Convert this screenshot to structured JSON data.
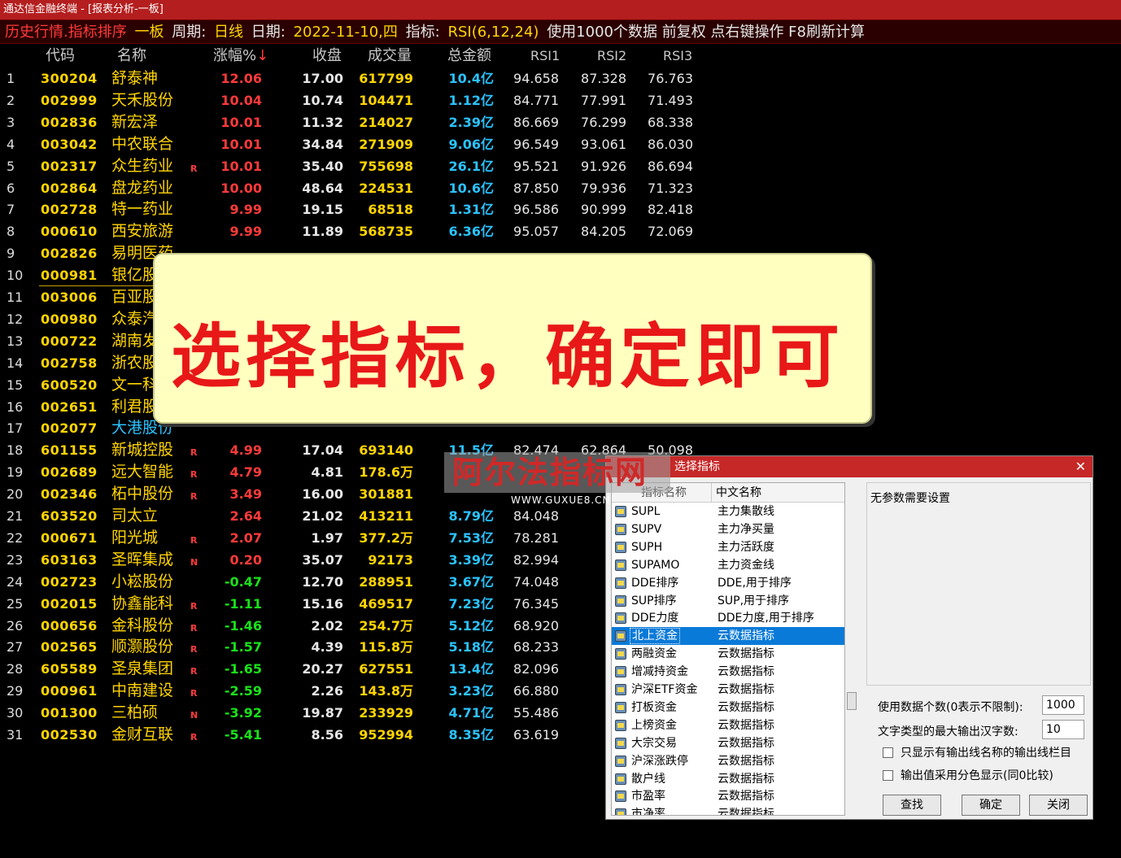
{
  "window": {
    "title": "通达信金融终端 - [报表分析-一板]"
  },
  "infobar": {
    "module": "历史行情.指标排序",
    "board": "一板",
    "period_label": "周期:",
    "period_value": "日线",
    "date_label": "日期:",
    "date_value": "2022-11-10,四",
    "indicator_label": "指标:",
    "indicator_value": "RSI(6,12,24)",
    "tail": "使用1000个数据 前复权 点右键操作 F8刷新计算"
  },
  "table": {
    "headers": [
      "代码",
      "名称",
      "涨幅%",
      "收盘",
      "成交量",
      "总金额",
      "RSI1",
      "RSI2",
      "RSI3"
    ],
    "sort_arrow": "↓",
    "rows": [
      {
        "i": "1",
        "code": "300204",
        "name": "舒泰神",
        "flag": "",
        "chg": "12.06",
        "close": "17.00",
        "vol": "617799",
        "amt": "10.4亿",
        "r1": "94.658",
        "r2": "87.328",
        "r3": "76.763"
      },
      {
        "i": "2",
        "code": "002999",
        "name": "天禾股份",
        "flag": "",
        "chg": "10.04",
        "close": "10.74",
        "vol": "104471",
        "amt": "1.12亿",
        "r1": "84.771",
        "r2": "77.991",
        "r3": "71.493"
      },
      {
        "i": "3",
        "code": "002836",
        "name": "新宏泽",
        "flag": "",
        "chg": "10.01",
        "close": "11.32",
        "vol": "214027",
        "amt": "2.39亿",
        "r1": "86.669",
        "r2": "76.299",
        "r3": "68.338"
      },
      {
        "i": "4",
        "code": "003042",
        "name": "中农联合",
        "flag": "",
        "chg": "10.01",
        "close": "34.84",
        "vol": "271909",
        "amt": "9.06亿",
        "r1": "96.549",
        "r2": "93.061",
        "r3": "86.030"
      },
      {
        "i": "5",
        "code": "002317",
        "name": "众生药业",
        "flag": "R",
        "chg": "10.01",
        "close": "35.40",
        "vol": "755698",
        "amt": "26.1亿",
        "r1": "95.521",
        "r2": "91.926",
        "r3": "86.694"
      },
      {
        "i": "6",
        "code": "002864",
        "name": "盘龙药业",
        "flag": "",
        "chg": "10.00",
        "close": "48.64",
        "vol": "224531",
        "amt": "10.6亿",
        "r1": "87.850",
        "r2": "79.936",
        "r3": "71.323"
      },
      {
        "i": "7",
        "code": "002728",
        "name": "特一药业",
        "flag": "",
        "chg": "9.99",
        "close": "19.15",
        "vol": "68518",
        "amt": "1.31亿",
        "r1": "96.586",
        "r2": "90.999",
        "r3": "82.418"
      },
      {
        "i": "8",
        "code": "000610",
        "name": "西安旅游",
        "flag": "",
        "chg": "9.99",
        "close": "11.89",
        "vol": "568735",
        "amt": "6.36亿",
        "r1": "95.057",
        "r2": "84.205",
        "r3": "72.069"
      },
      {
        "i": "9",
        "code": "002826",
        "name": "易明医药",
        "flag": "",
        "chg": "",
        "close": "",
        "vol": "",
        "amt": "",
        "r1": "",
        "r2": "",
        "r3": ""
      },
      {
        "i": "10",
        "code": "000981",
        "name": "银亿股份",
        "flag": "",
        "chg": "",
        "close": "",
        "vol": "",
        "amt": "",
        "r1": "",
        "r2": "",
        "r3": ""
      },
      {
        "i": "11",
        "code": "003006",
        "name": "百亚股份",
        "flag": "",
        "chg": "",
        "close": "",
        "vol": "",
        "amt": "",
        "r1": "",
        "r2": "",
        "r3": ""
      },
      {
        "i": "12",
        "code": "000980",
        "name": "众泰汽车",
        "flag": "",
        "chg": "",
        "close": "",
        "vol": "",
        "amt": "",
        "r1": "",
        "r2": "",
        "r3": ""
      },
      {
        "i": "13",
        "code": "000722",
        "name": "湖南发展",
        "flag": "",
        "chg": "",
        "close": "",
        "vol": "",
        "amt": "",
        "r1": "",
        "r2": "",
        "r3": ""
      },
      {
        "i": "14",
        "code": "002758",
        "name": "浙农股份",
        "flag": "",
        "chg": "",
        "close": "",
        "vol": "",
        "amt": "",
        "r1": "",
        "r2": "",
        "r3": ""
      },
      {
        "i": "15",
        "code": "600520",
        "name": "文一科技",
        "flag": "",
        "chg": "",
        "close": "",
        "vol": "",
        "amt": "",
        "r1": "",
        "r2": "",
        "r3": ""
      },
      {
        "i": "16",
        "code": "002651",
        "name": "利君股份",
        "flag": "",
        "chg": "",
        "close": "",
        "vol": "",
        "amt": "",
        "r1": "",
        "r2": "",
        "r3": ""
      },
      {
        "i": "17",
        "code": "002077",
        "name": "大港股份",
        "flag": "",
        "chg": "",
        "close": "",
        "vol": "",
        "amt": "",
        "r1": "",
        "r2": "",
        "r3": ""
      },
      {
        "i": "18",
        "code": "601155",
        "name": "新城控股",
        "flag": "R",
        "chg": "4.99",
        "close": "17.04",
        "vol": "693140",
        "amt": "11.5亿",
        "r1": "82.474",
        "r2": "62.864",
        "r3": "50.098"
      },
      {
        "i": "19",
        "code": "002689",
        "name": "远大智能",
        "flag": "R",
        "chg": "4.79",
        "close": "4.81",
        "vol": "178.6万",
        "amt": "",
        "r1": "",
        "r2": "",
        "r3": ""
      },
      {
        "i": "20",
        "code": "002346",
        "name": "柘中股份",
        "flag": "R",
        "chg": "3.49",
        "close": "16.00",
        "vol": "301881",
        "amt": "",
        "r1": "",
        "r2": "",
        "r3": ""
      },
      {
        "i": "21",
        "code": "603520",
        "name": "司太立",
        "flag": "",
        "chg": "2.64",
        "close": "21.02",
        "vol": "413211",
        "amt": "8.79亿",
        "r1": "84.048",
        "r2": "",
        "r3": ""
      },
      {
        "i": "22",
        "code": "000671",
        "name": "阳光城",
        "flag": "R",
        "chg": "2.07",
        "close": "1.97",
        "vol": "377.2万",
        "amt": "7.53亿",
        "r1": "78.281",
        "r2": "",
        "r3": ""
      },
      {
        "i": "23",
        "code": "603163",
        "name": "圣晖集成",
        "flag": "N",
        "chg": "0.20",
        "close": "35.07",
        "vol": "92173",
        "amt": "3.39亿",
        "r1": "82.994",
        "r2": "",
        "r3": ""
      },
      {
        "i": "24",
        "code": "002723",
        "name": "小崧股份",
        "flag": "",
        "chg": "-0.47",
        "close": "12.70",
        "vol": "288951",
        "amt": "3.67亿",
        "r1": "74.048",
        "r2": "",
        "r3": ""
      },
      {
        "i": "25",
        "code": "002015",
        "name": "协鑫能科",
        "flag": "R",
        "chg": "-1.11",
        "close": "15.16",
        "vol": "469517",
        "amt": "7.23亿",
        "r1": "76.345",
        "r2": "",
        "r3": ""
      },
      {
        "i": "26",
        "code": "000656",
        "name": "金科股份",
        "flag": "R",
        "chg": "-1.46",
        "close": "2.02",
        "vol": "254.7万",
        "amt": "5.12亿",
        "r1": "68.920",
        "r2": "",
        "r3": ""
      },
      {
        "i": "27",
        "code": "002565",
        "name": "顺灏股份",
        "flag": "R",
        "chg": "-1.57",
        "close": "4.39",
        "vol": "115.8万",
        "amt": "5.18亿",
        "r1": "68.233",
        "r2": "",
        "r3": ""
      },
      {
        "i": "28",
        "code": "605589",
        "name": "圣泉集团",
        "flag": "R",
        "chg": "-1.65",
        "close": "20.27",
        "vol": "627551",
        "amt": "13.4亿",
        "r1": "82.096",
        "r2": "",
        "r3": ""
      },
      {
        "i": "29",
        "code": "000961",
        "name": "中南建设",
        "flag": "R",
        "chg": "-2.59",
        "close": "2.26",
        "vol": "143.8万",
        "amt": "3.23亿",
        "r1": "66.880",
        "r2": "",
        "r3": ""
      },
      {
        "i": "30",
        "code": "001300",
        "name": "三柏硕",
        "flag": "N",
        "chg": "-3.92",
        "close": "19.87",
        "vol": "233929",
        "amt": "4.71亿",
        "r1": "55.486",
        "r2": "",
        "r3": ""
      },
      {
        "i": "31",
        "code": "002530",
        "name": "金财互联",
        "flag": "R",
        "chg": "-5.41",
        "close": "8.56",
        "vol": "952994",
        "amt": "8.35亿",
        "r1": "63.619",
        "r2": "",
        "r3": ""
      }
    ]
  },
  "banner": {
    "text": "选择指标，确定即可"
  },
  "watermark": {
    "main": "阿尔法指标网",
    "sub": "WWW.GUXUE8.CN"
  },
  "dialog": {
    "title": "选择指标",
    "close": "✕",
    "list_headers": [
      "指标名称",
      "中文名称"
    ],
    "items": [
      {
        "name": "SUPL",
        "cn": "主力集散线"
      },
      {
        "name": "SUPV",
        "cn": "主力净买量"
      },
      {
        "name": "SUPH",
        "cn": "主力活跃度"
      },
      {
        "name": "SUPAMO",
        "cn": "主力资金线"
      },
      {
        "name": "DDE排序",
        "cn": "DDE,用于排序"
      },
      {
        "name": "SUP排序",
        "cn": "SUP,用于排序"
      },
      {
        "name": "DDE力度",
        "cn": "DDE力度,用于排序"
      },
      {
        "name": "北上资金",
        "cn": "云数据指标",
        "selected": true
      },
      {
        "name": "两融资金",
        "cn": "云数据指标"
      },
      {
        "name": "增减持资金",
        "cn": "云数据指标"
      },
      {
        "name": "沪深ETF资金",
        "cn": "云数据指标"
      },
      {
        "name": "打板资金",
        "cn": "云数据指标"
      },
      {
        "name": "上榜资金",
        "cn": "云数据指标"
      },
      {
        "name": "大宗交易",
        "cn": "云数据指标"
      },
      {
        "name": "沪深涨跌停",
        "cn": "云数据指标"
      },
      {
        "name": "散户线",
        "cn": "云数据指标"
      },
      {
        "name": "市盈率",
        "cn": "云数据指标"
      },
      {
        "name": "市净率",
        "cn": "云数据指标"
      }
    ],
    "param_text": "无参数需要设置",
    "data_count_label": "使用数据个数(0表示不限制):",
    "data_count_value": "1000",
    "max_chars_label": "文字类型的最大输出汉字数:",
    "max_chars_value": "10",
    "check1": "只显示有输出线名称的输出线栏目",
    "check2": "输出值采用分色显示(同0比较)",
    "btn_find": "查找",
    "btn_ok": "确定",
    "btn_close": "关闭"
  }
}
